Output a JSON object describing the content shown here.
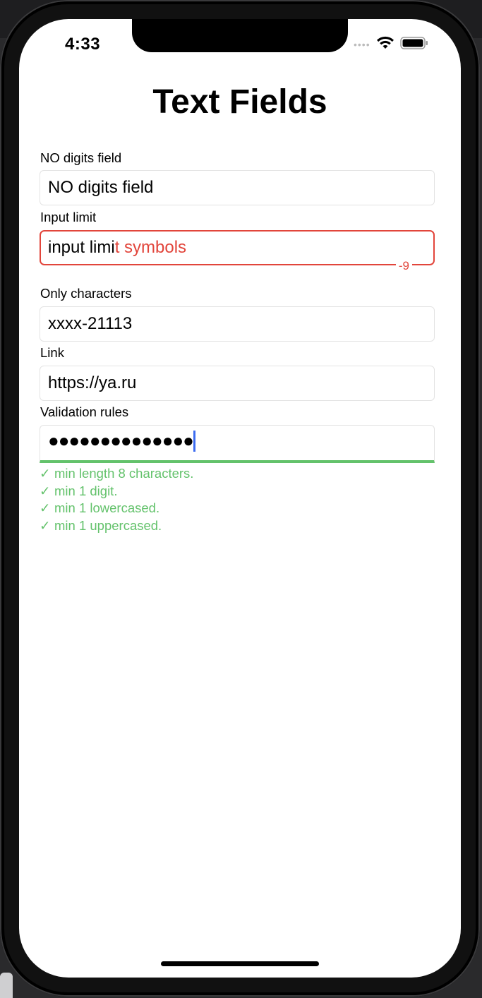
{
  "status_bar": {
    "time": "4:33",
    "signal_icon": "signal-dots-icon",
    "wifi_icon": "wifi-icon",
    "battery_icon": "battery-icon"
  },
  "screen": {
    "title": "Text Fields"
  },
  "fields": {
    "no_digits": {
      "label": "NO digits field",
      "value": "NO digits field"
    },
    "input_limit": {
      "label": "Input limit",
      "value_in_limit": "input limi",
      "value_over_limit": "t symbols",
      "counter": "-9",
      "error_color": "#e2453b"
    },
    "only_characters": {
      "label": "Only characters",
      "value": "xxxx-21113"
    },
    "link": {
      "label": "Link",
      "value": "https://ya.ru"
    },
    "validation": {
      "label": "Validation rules",
      "masked_value": "●●●●●●●●●●●●●●",
      "valid_color": "#63c26b",
      "rules": [
        {
          "check": "✓",
          "text": "min length 8 characters."
        },
        {
          "check": "✓",
          "text": "min 1 digit."
        },
        {
          "check": "✓",
          "text": "min 1 lowercased."
        },
        {
          "check": "✓",
          "text": "min 1 uppercased."
        }
      ]
    }
  },
  "accent_color": "#3c6cf0"
}
